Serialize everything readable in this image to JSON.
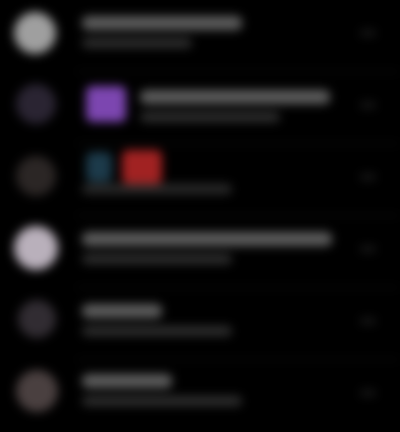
{
  "theme": {
    "background": "#000000",
    "text_primary": "#5d5d5d",
    "text_secondary": "#2f2f2f"
  },
  "rows": [
    {
      "avatar_color": "#9f9f9f",
      "thumb": ""
    },
    {
      "avatar_color": "#2a2432",
      "thumb": "purple"
    },
    {
      "avatar_color": "#2b2625",
      "thumb": "blue-red"
    },
    {
      "avatar_color": "#b9b0bb",
      "thumb": ""
    },
    {
      "avatar_color": "#312c32",
      "thumb": ""
    },
    {
      "avatar_color": "#4a4040",
      "thumb": ""
    }
  ]
}
